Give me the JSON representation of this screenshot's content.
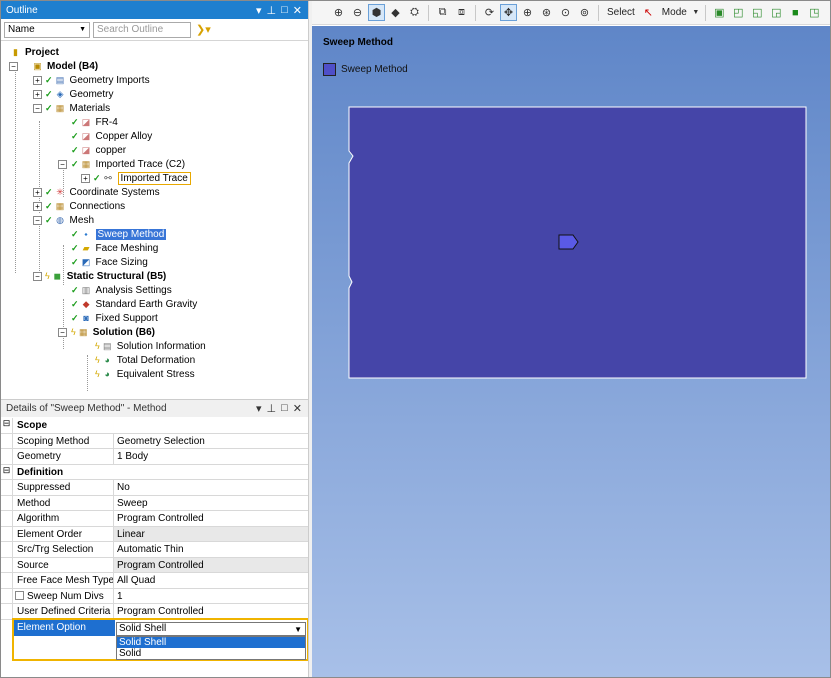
{
  "outline": {
    "title": "Outline",
    "filter_select": "Name",
    "search_placeholder": "Search Outline",
    "tree": [
      {
        "label": "Project"
      },
      {
        "label": "Model (B4)"
      },
      {
        "label": "Geometry Imports"
      },
      {
        "label": "Geometry"
      },
      {
        "label": "Materials"
      },
      {
        "label": "FR-4"
      },
      {
        "label": "Copper Alloy"
      },
      {
        "label": "copper"
      },
      {
        "label": "Imported Trace (C2)"
      },
      {
        "label": "Imported Trace"
      },
      {
        "label": "Coordinate Systems"
      },
      {
        "label": "Connections"
      },
      {
        "label": "Mesh"
      },
      {
        "label": "Sweep Method"
      },
      {
        "label": "Face Meshing"
      },
      {
        "label": "Face Sizing"
      },
      {
        "label": "Static Structural (B5)"
      },
      {
        "label": "Analysis Settings"
      },
      {
        "label": "Standard Earth Gravity"
      },
      {
        "label": "Fixed Support"
      },
      {
        "label": "Solution (B6)"
      },
      {
        "label": "Solution Information"
      },
      {
        "label": "Total Deformation"
      },
      {
        "label": "Equivalent Stress"
      }
    ]
  },
  "details": {
    "title": "Details of \"Sweep Method\" - Method",
    "rows": [
      {
        "key": "Scope",
        "category": true
      },
      {
        "key": "Scoping Method",
        "value": "Geometry Selection"
      },
      {
        "key": "Geometry",
        "value": "1 Body"
      },
      {
        "key": "Definition",
        "category": true
      },
      {
        "key": "Suppressed",
        "value": "No"
      },
      {
        "key": "Method",
        "value": "Sweep"
      },
      {
        "key": "Algorithm",
        "value": "Program Controlled"
      },
      {
        "key": "Element Order",
        "value": "Linear"
      },
      {
        "key": "Src/Trg Selection",
        "value": "Automatic Thin"
      },
      {
        "key": "Source",
        "value": "Program Controlled"
      },
      {
        "key": "Free Face Mesh Type",
        "value": "All Quad"
      },
      {
        "key": "Sweep Num Divs",
        "value": "1"
      },
      {
        "key": "User Defined Criteria",
        "value": "Program Controlled"
      }
    ],
    "element_option": {
      "key": "Element Option",
      "value": "Solid Shell",
      "options": [
        "Solid Shell",
        "Solid"
      ]
    }
  },
  "toolbar": {
    "select_label": "Select",
    "mode_label": "Mode"
  },
  "viewport": {
    "title": "Sweep Method",
    "legend": "Sweep Method",
    "body_color": "#4545a8"
  }
}
